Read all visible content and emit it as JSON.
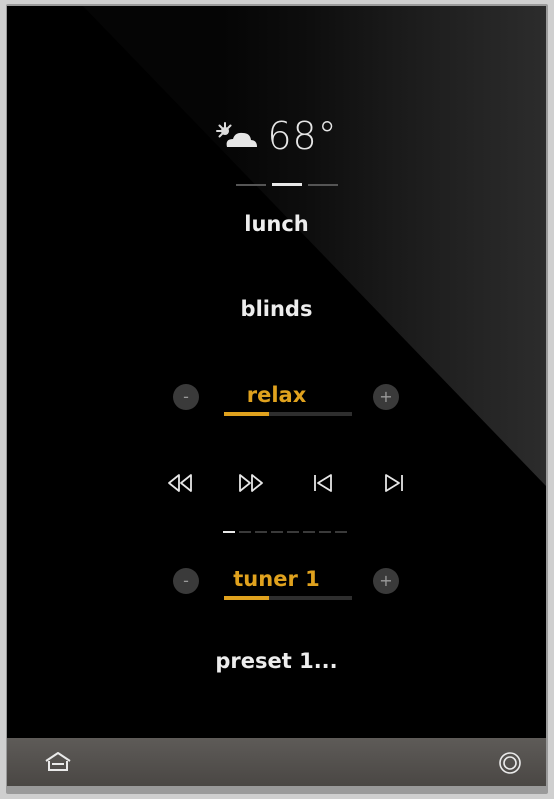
{
  "weather": {
    "icon": "partly-cloudy-icon",
    "temperature": "68°"
  },
  "pager": {
    "pages": 3,
    "active_index": 1
  },
  "scenes": {
    "item_1": "lunch",
    "item_2": "blinds"
  },
  "lighting": {
    "title": "relax",
    "minus_label": "-",
    "plus_label": "+",
    "level_fraction": 0.35
  },
  "transport": {
    "buttons": [
      "rewind-icon",
      "fast-forward-icon",
      "skip-previous-icon",
      "skip-next-icon"
    ]
  },
  "media_pager": {
    "pages": 8,
    "active_index": 0
  },
  "source": {
    "title": "tuner 1",
    "minus_label": "-",
    "plus_label": "+",
    "level_fraction": 0.35
  },
  "preset": {
    "label": "preset 1..."
  },
  "bottom_bar": {
    "left_icon": "home-icon",
    "right_icon": "power-icon"
  },
  "colors": {
    "accent": "#e0a21e",
    "text": "#ededed",
    "background": "#000000",
    "bar": "#55524f"
  }
}
